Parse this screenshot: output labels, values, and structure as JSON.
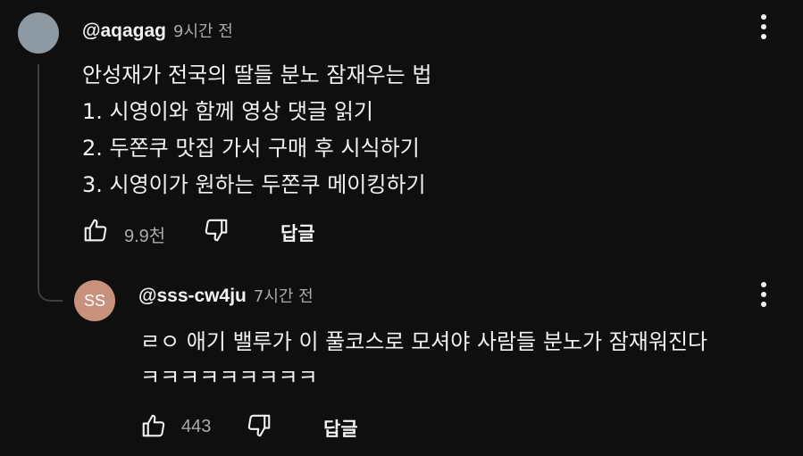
{
  "comment": {
    "handle": "@aqagag",
    "time": "9시간 전",
    "lines": "안성재가 전국의 딸들 분노 잠재우는 법\n1. 시영이와 함께 영상 댓글 읽기\n2. 두쫀쿠 맛집 가서 구매 후 시식하기\n3. 시영이가 원하는 두쫀쿠 메이킹하기",
    "like_count": "9.9천",
    "reply_label": "답글"
  },
  "reply": {
    "avatar_initials": "SS",
    "handle": "@sss-cw4ju",
    "time": "7시간 전",
    "lines": "ㄹㅇ 애기 밸루가 이 풀코스로 모셔야 사람들 분노가 잠재워진다\nㅋㅋㅋㅋㅋㅋㅋㅋㅋ",
    "like_count": "443",
    "reply_label": "답글"
  },
  "colors": {
    "background": "#0f0f0f",
    "text": "#f1f1f1",
    "secondary_text": "#aaaaaa",
    "avatar1": "#8d99a3",
    "avatar2": "#c8917c"
  },
  "icons": [
    "thumb-up-icon",
    "thumb-down-icon",
    "more-vert-icon"
  ]
}
